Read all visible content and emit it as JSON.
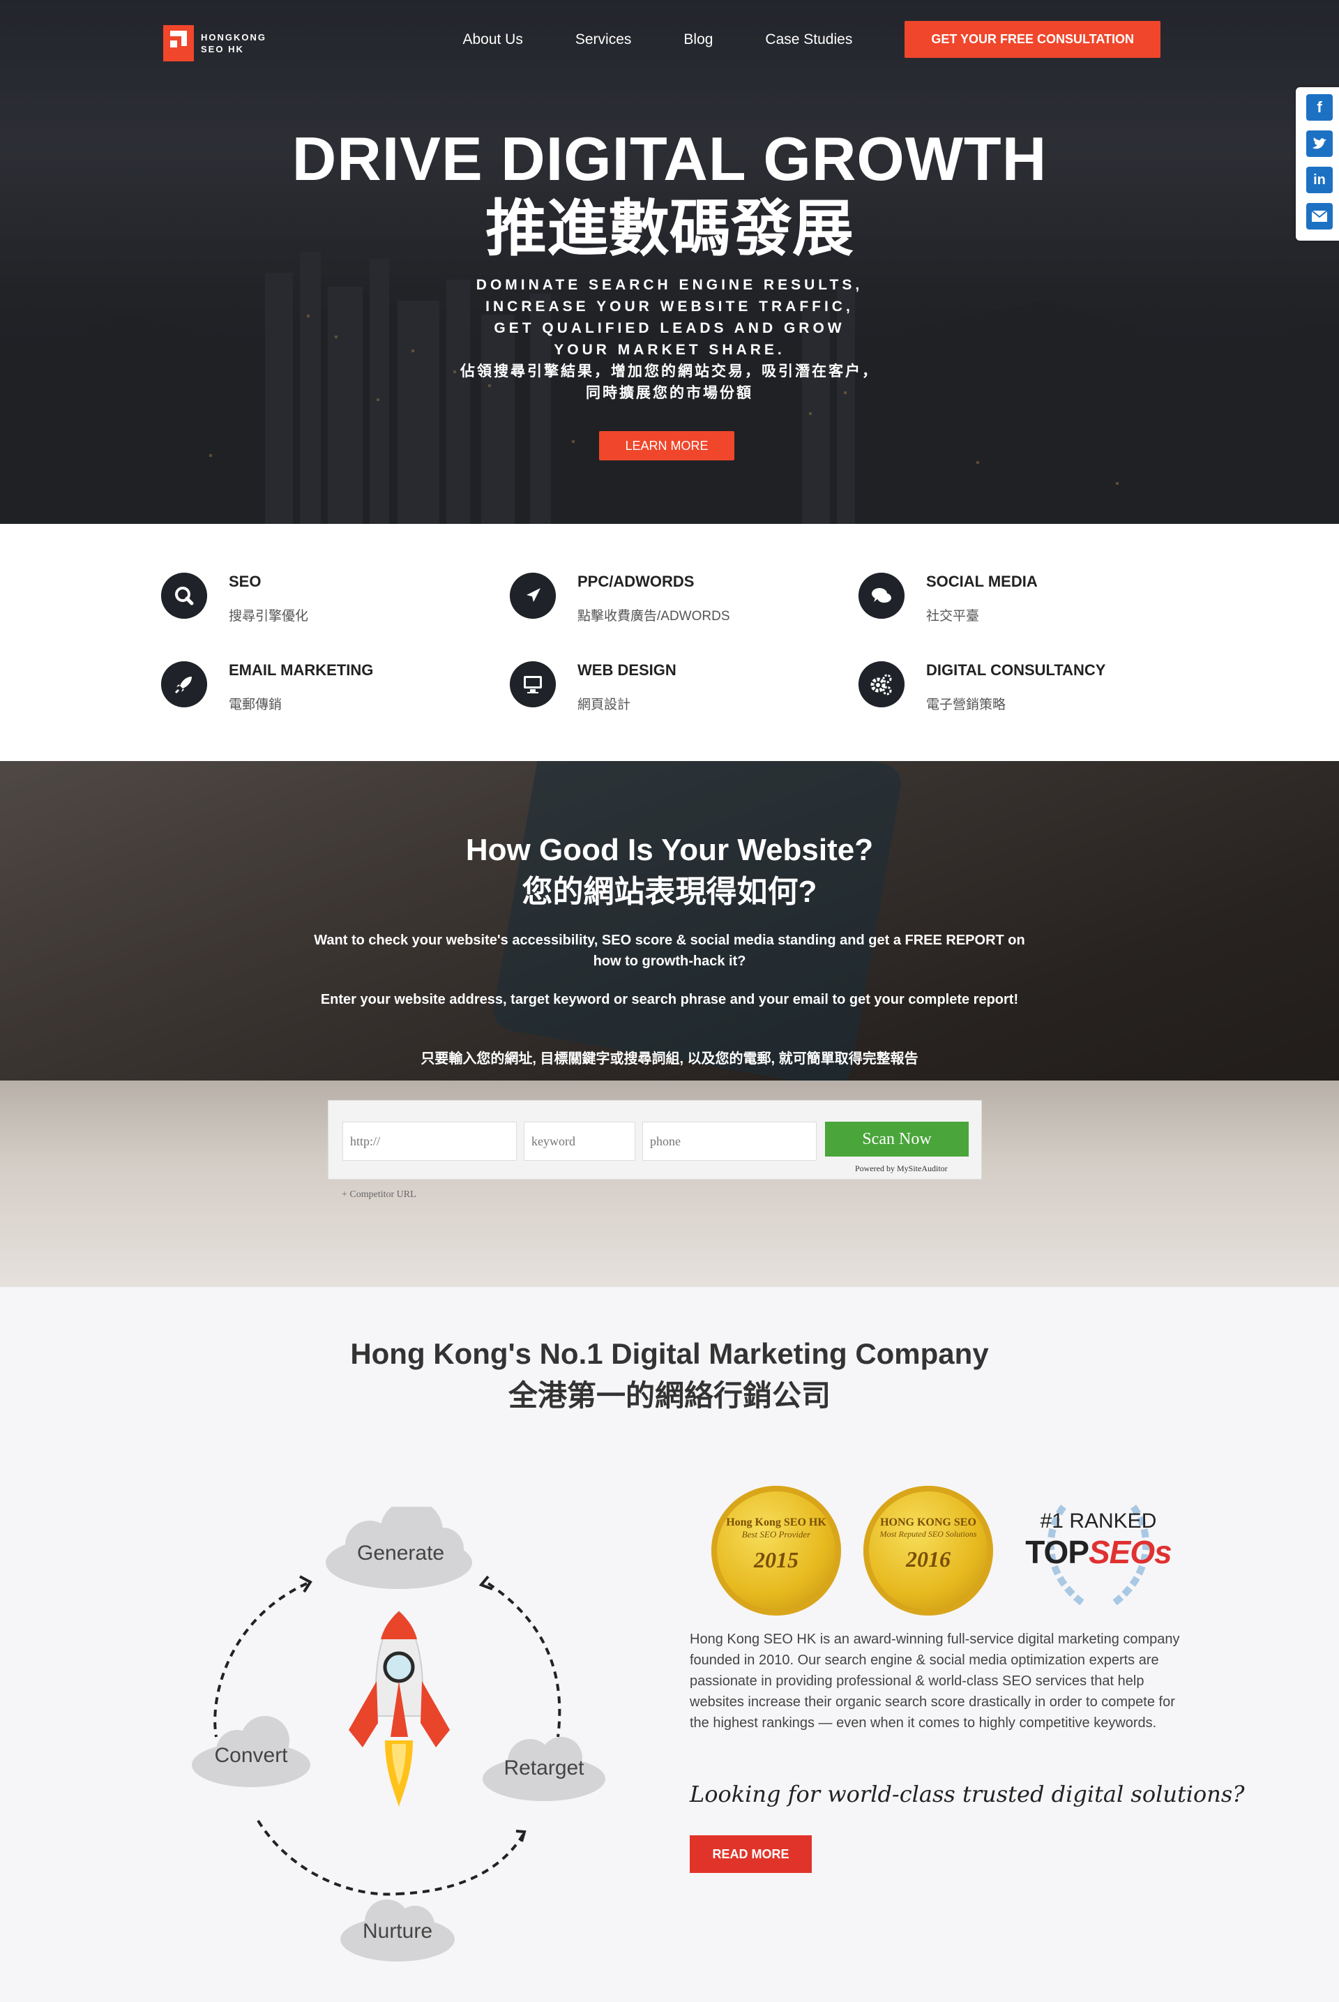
{
  "brand": {
    "line1": "HONGKONG",
    "line2": "SEO HK",
    "accent": "#f0462b"
  },
  "nav": {
    "items": [
      {
        "label": "About Us"
      },
      {
        "label": "Services"
      },
      {
        "label": "Blog"
      },
      {
        "label": "Case Studies"
      }
    ],
    "cta": "GET YOUR FREE CONSULTATION"
  },
  "hero": {
    "title_en": "DRIVE DIGITAL GROWTH",
    "title_zh": "推進數碼發展",
    "sub_lines": [
      "DOMINATE SEARCH ENGINE RESULTS,",
      "INCREASE YOUR WEBSITE TRAFFIC,",
      "GET QUALIFIED LEADS AND GROW",
      "YOUR MARKET SHARE.",
      "佔領搜尋引擎結果，增加您的網站交易，吸引潛在客户，",
      "同時擴展您的市場份額"
    ],
    "button": "LEARN MORE"
  },
  "share": {
    "icons": [
      "facebook-icon",
      "twitter-icon",
      "linkedin-icon",
      "email-icon"
    ],
    "color": "#1d71c3"
  },
  "services": [
    {
      "title": "SEO",
      "desc": "搜尋引擎優化",
      "icon": "search-icon"
    },
    {
      "title": "PPC/ADWORDS",
      "desc": "點擊收費廣告/ADWORDS",
      "icon": "navigation-arrow-icon"
    },
    {
      "title": "SOCIAL MEDIA",
      "desc": "社交平臺",
      "icon": "chat-bubbles-icon"
    },
    {
      "title": "EMAIL MARKETING",
      "desc": "電郵傳銷",
      "icon": "rocket-icon"
    },
    {
      "title": "WEB DESIGN",
      "desc": "網頁設計",
      "icon": "monitor-icon"
    },
    {
      "title": "DIGITAL CONSULTANCY",
      "desc": "電子營銷策略",
      "icon": "gears-icon"
    }
  ],
  "scan": {
    "title_en": "How Good Is Your Website?",
    "title_zh": "您的網站表現得如何?",
    "p1": "Want to check your website's accessibility, SEO score & social media standing and get a FREE REPORT on how to growth-hack it?",
    "p2": "Enter your website address, target keyword or search phrase and your email to get your complete report!",
    "p3": "只要輸入您的網址, 目標關鍵字或搜尋詞組, 以及您的電郵, 就可簡單取得完整報告",
    "url_placeholder": "http://",
    "keyword_placeholder": "keyword",
    "phone_placeholder": "phone",
    "button": "Scan Now",
    "powered": "Powered by MySiteAuditor",
    "competitor": "+ Competitor URL",
    "button_color": "#4aa53b"
  },
  "company": {
    "title_en": "Hong Kong's No.1 Digital Marketing Company",
    "title_zh": "全港第一的網絡行銷公司",
    "cycle": [
      "Generate",
      "Retarget",
      "Nurture",
      "Convert"
    ],
    "badges": [
      {
        "top": "Hong Kong SEO HK",
        "sub": "Best SEO Provider",
        "year": "2015"
      },
      {
        "top": "HONG KONG SEO",
        "sub": "Most Reputed SEO Solutions",
        "year": "2016"
      }
    ],
    "ranked_line1": "#1 RANKED",
    "ranked_line2a": "TOP",
    "ranked_line2b": "SEOs",
    "about": "Hong Kong SEO HK is an award-winning full-service digital marketing company founded in 2010. Our search engine & social media optimization experts are passionate in providing professional & world-class SEO services that help websites increase their organic search score drastically in order to compete for the highest rankings — even when it comes to highly competitive keywords.",
    "tagline": "Looking for world-class trusted digital solutions?",
    "button": "READ MORE"
  }
}
